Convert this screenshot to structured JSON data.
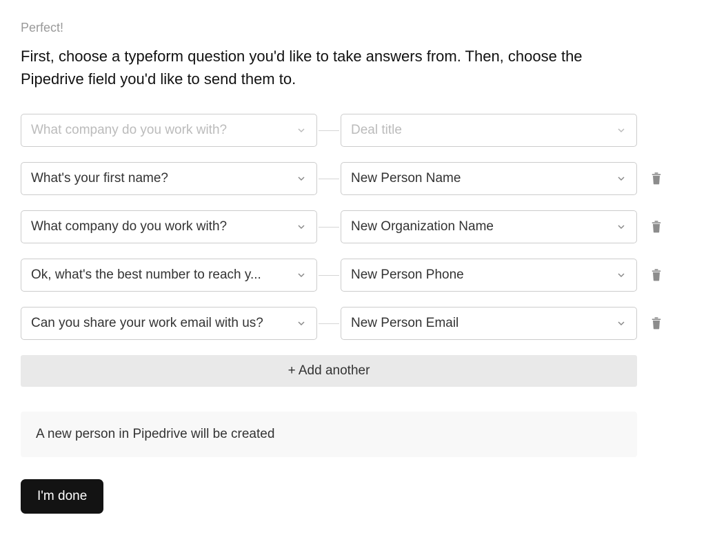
{
  "header": {
    "small": "Perfect!",
    "main": "First, choose a typeform question you'd like to take answers from. Then, choose the Pipedrive field you'd like to send them to."
  },
  "mappings": [
    {
      "source_placeholder": "What company do you work with?",
      "target_placeholder": "Deal title",
      "is_placeholder": true,
      "has_delete": false
    },
    {
      "source": "What's your first name?",
      "target": "New Person Name",
      "is_placeholder": false,
      "has_delete": true
    },
    {
      "source": "What company do you work with?",
      "target": "New Organization Name",
      "is_placeholder": false,
      "has_delete": true
    },
    {
      "source": "Ok, what's the best number to reach y...",
      "target": "New Person Phone",
      "is_placeholder": false,
      "has_delete": true
    },
    {
      "source": "Can you share your work email with us?",
      "target": "New Person Email",
      "is_placeholder": false,
      "has_delete": true
    }
  ],
  "buttons": {
    "add_another": "+ Add another",
    "done": "I'm done"
  },
  "info": {
    "text": "A new person in Pipedrive will be created"
  }
}
